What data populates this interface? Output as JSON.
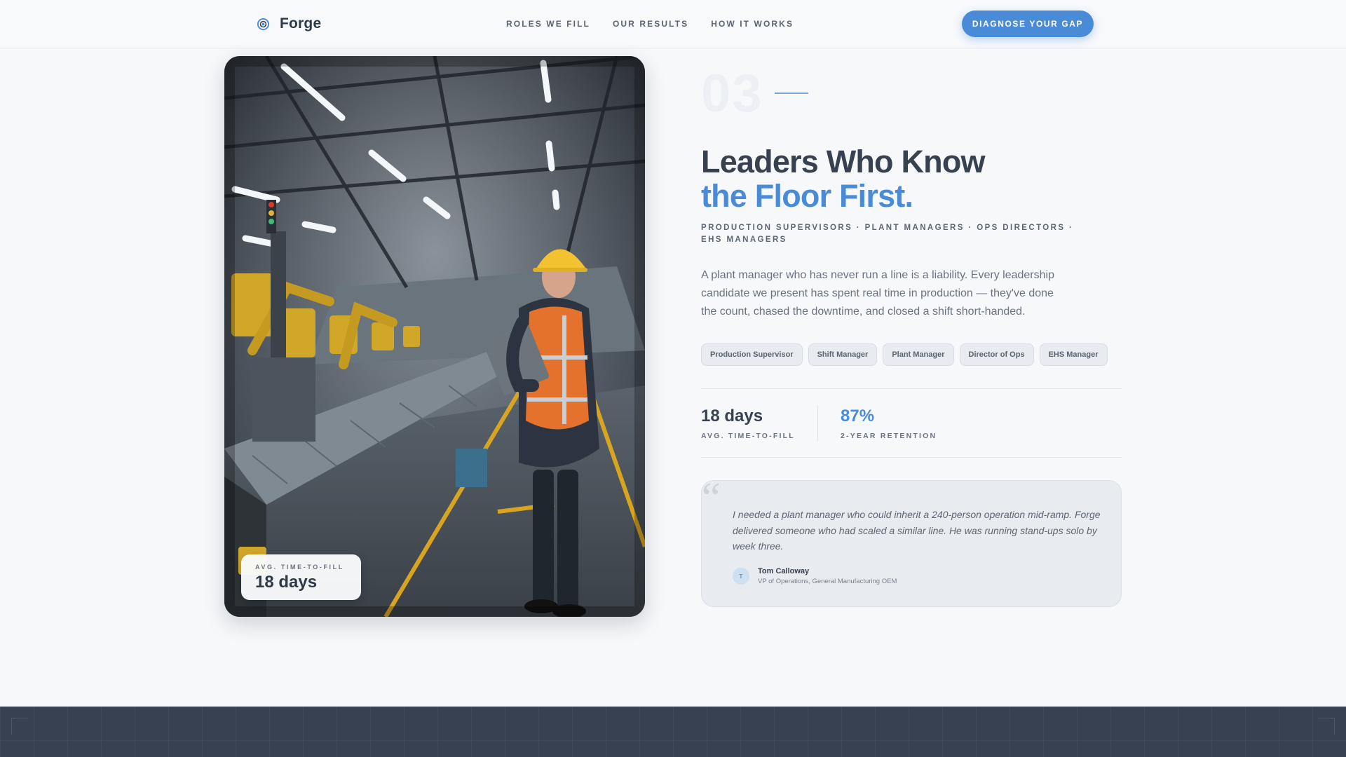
{
  "nav": {
    "brand": "Forge",
    "links": [
      "ROLES WE FILL",
      "OUR RESULTS",
      "HOW IT WORKS"
    ],
    "cta": "DIAGNOSE YOUR GAP"
  },
  "photo": {
    "badge_label": "AVG. TIME-TO-FILL",
    "badge_value": "18 days"
  },
  "section": {
    "number": "03",
    "headline_line1": "Leaders Who Know",
    "headline_line2": "the Floor First.",
    "roles_line": "PRODUCTION SUPERVISORS · PLANT MANAGERS · OPS DIRECTORS · EHS MANAGERS",
    "description": "A plant manager who has never run a line is a liability. Every leadership candidate we present has spent real time in production — they've done the count, chased the downtime, and closed a shift short-handed.",
    "tags": [
      "Production Supervisor",
      "Shift Manager",
      "Plant Manager",
      "Director of Ops",
      "EHS Manager"
    ],
    "stats": [
      {
        "value": "18 days",
        "label": "AVG. TIME-TO-FILL",
        "color": "#37414f"
      },
      {
        "value": "87%",
        "label": "2-YEAR RETENTION",
        "color": "#4a8bd8"
      }
    ],
    "testimonial": {
      "quote": "I needed a plant manager who could inherit a 240-person operation mid-ramp. Forge delivered someone who had scaled a similar line. He was running stand-ups solo by week three.",
      "initial": "T",
      "author": "Tom Calloway",
      "role": "VP of Operations, General Manufacturing OEM"
    }
  },
  "colors": {
    "accent": "#4a8bd8",
    "heading": "#37414f",
    "footer": "#374151"
  }
}
